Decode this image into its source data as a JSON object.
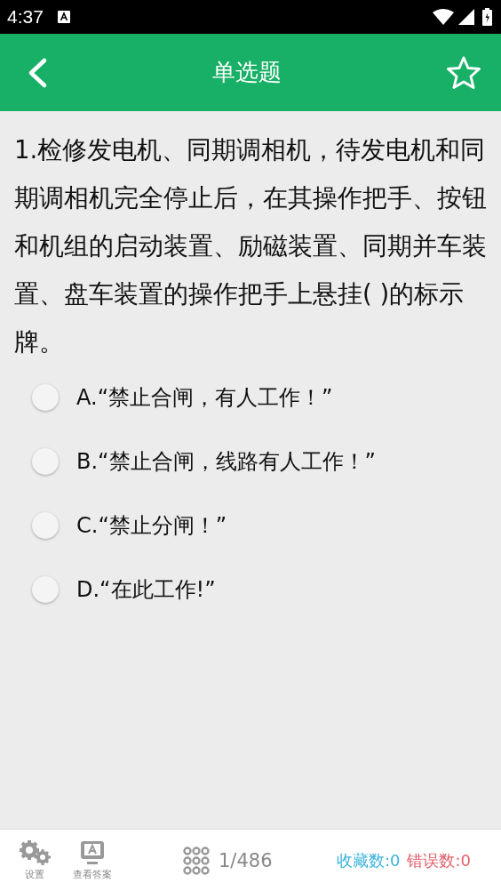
{
  "status_bar": {
    "time": "4:37"
  },
  "header": {
    "title": "单选题",
    "starred": false
  },
  "question": {
    "text": "1.检修发电机、同期调相机，待发电机和同期调相机完全停止后，在其操作把手、按钮和机组的启动装置、励磁装置、同期并车装置、盘车装置的操作把手上悬挂( )的标示牌。",
    "options": [
      {
        "label": "A.“禁止合闸，有人工作！”",
        "selected": false
      },
      {
        "label": "B.“禁止合闸，线路有人工作！”",
        "selected": false
      },
      {
        "label": "C.“禁止分闸！”",
        "selected": false
      },
      {
        "label": "D.“在此工作!”",
        "selected": false
      }
    ]
  },
  "footer": {
    "settings_label": "设置",
    "answer_label": "查看答案",
    "progress": "1/486",
    "favorites": "收藏数:0",
    "errors": "错误数:0"
  }
}
